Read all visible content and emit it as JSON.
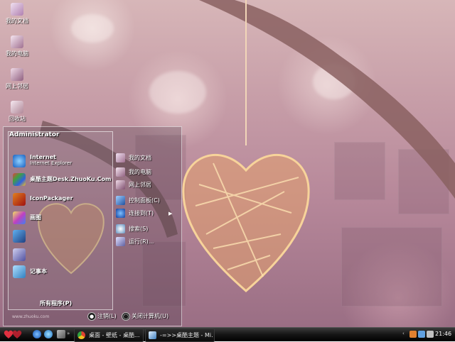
{
  "desktop": {
    "icons": [
      {
        "label": "我的文档",
        "icon": "my-documents-icon"
      },
      {
        "label": "我的电脑",
        "icon": "my-computer-icon"
      },
      {
        "label": "网上邻居",
        "icon": "network-places-icon"
      },
      {
        "label": "回收站",
        "icon": "recycle-bin-icon"
      }
    ]
  },
  "start_menu": {
    "user_name": "Administrator",
    "pinned": [
      {
        "title": "Internet",
        "subtitle": "Internet Explorer",
        "icon": "internet-explorer-icon"
      },
      {
        "title": "桌酷主题Desk.ZhuoKu.Com",
        "subtitle": "",
        "icon": "zhuoku-theme-icon"
      },
      {
        "title": "IconPackager",
        "subtitle": "",
        "icon": "iconpackager-icon"
      },
      {
        "title": "画图",
        "subtitle": "",
        "icon": "paint-icon"
      },
      {
        "title": "",
        "subtitle": "",
        "icon": "program-icon-1"
      },
      {
        "title": "",
        "subtitle": "",
        "icon": "program-icon-2"
      },
      {
        "title": "记事本",
        "subtitle": "",
        "icon": "notepad-icon"
      }
    ],
    "all_programs": "所有程序(P)",
    "right_items": [
      {
        "label": "我的文档",
        "icon": "my-documents-icon"
      },
      {
        "label": "我的电脑",
        "icon": "my-computer-icon"
      },
      {
        "label": "网上邻居",
        "icon": "network-places-icon"
      },
      {
        "label": "控制面板(C)",
        "icon": "control-panel-icon"
      },
      {
        "label": "连接到(T)",
        "icon": "connect-to-icon"
      },
      {
        "label": "搜索(S)",
        "icon": "search-icon"
      },
      {
        "label": "运行(R)...",
        "icon": "run-icon"
      }
    ],
    "footer_url": "www.zhuoku.com",
    "logoff_label": "注销(L)",
    "shutdown_label": "关闭计算机(U)"
  },
  "taskbar": {
    "tasks": [
      {
        "label": "桌面 - 壁纸 - 桌酷...",
        "icon": "chrome-icon"
      },
      {
        "label": "-=>>桌酷主题 - Mi...",
        "icon": "document-icon"
      }
    ],
    "clock": "21:46"
  },
  "colors": {
    "taskbar_bg": "#111111",
    "heart": "#e8a070",
    "wallpaper_pink": "#c79ea8"
  }
}
